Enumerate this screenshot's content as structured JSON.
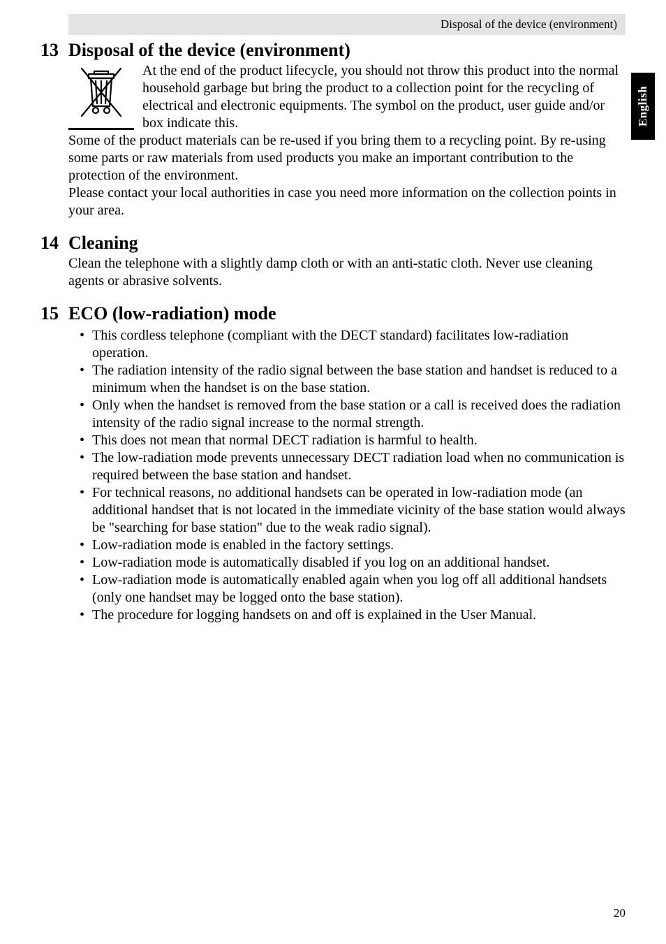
{
  "header": {
    "running_title": "Disposal of the device (environment)"
  },
  "side_tab": "English",
  "sections": {
    "s13": {
      "number": "13",
      "title": "Disposal of the device (environment)",
      "para1": "At the end of the product lifecycle, you should not throw this product into the normal household garbage but bring the product to a collection point for the recycling of electrical and electronic equipments. The symbol on the product, user guide and/or box indicate this.",
      "para2": "Some of the product materials can be re-used if you bring them to a recycling point. By re-using some parts or raw materials from used products you make an important contribution to the protection of the environment.",
      "para3": "Please contact your local authorities in case you need more information on the collection points in your area."
    },
    "s14": {
      "number": "14",
      "title": "Cleaning",
      "para1": "Clean the telephone with a slightly damp cloth or with an anti-static cloth. Never use cleaning agents or abrasive solvents."
    },
    "s15": {
      "number": "15",
      "title": "ECO (low-radiation) mode",
      "bullets": [
        "This cordless telephone (compliant with the DECT standard) facilitates low-radiation operation.",
        "The radiation intensity of the radio signal between the base station and handset is reduced to a minimum when the handset is on the base station.",
        "Only when the handset is removed from the base station or a call is received does the radiation intensity of the radio signal increase to the normal strength.",
        "This does not mean that normal DECT radiation is harmful to health.",
        "The low-radiation mode prevents unnecessary DECT radiation load when no communication is required between the base station and handset.",
        "For technical reasons, no additional handsets can be operated in low-radiation mode (an additional handset that is not located in the immediate vicinity of the base station would always be \"searching for base station\" due to the weak radio signal).",
        "Low-radiation mode is enabled in the factory settings.",
        "Low-radiation mode is automatically disabled if you log on an additional handset.",
        "Low-radiation mode is automatically enabled again when you log off all additional handsets (only one handset may be logged onto the base station).",
        "The procedure for logging handsets on and off is explained in the User Manual."
      ]
    }
  },
  "page_number": "20"
}
